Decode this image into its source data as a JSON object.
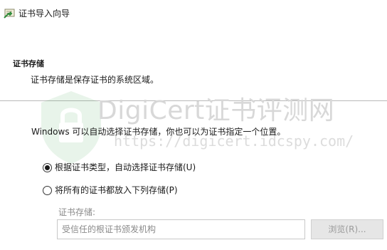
{
  "window": {
    "title": "证书导入向导",
    "icon": "certificate-wizard-icon"
  },
  "header": {
    "section_title": "证书存储",
    "section_desc": "证书存储是保存证书的系统区域。"
  },
  "watermark": {
    "brand": "DigiCert证书评测网",
    "url": "https://digicert.idcspy.com/"
  },
  "main": {
    "intro": "Windows 可以自动选择证书存储，你也可以为证书指定一个位置。",
    "options": [
      {
        "label": "根据证书类型，自动选择证书存储(U)",
        "checked": true
      },
      {
        "label": "将所有的证书都放入下列存储(P)",
        "checked": false
      }
    ],
    "store_label": "证书存储:",
    "store_value": "受信任的根证书颁发机构",
    "browse_label": "浏览(R)..."
  },
  "colors": {
    "divider": "#b9b9b9",
    "disabled_text": "#8a8a8a",
    "disabled_button_bg": "#e6e6e6"
  }
}
